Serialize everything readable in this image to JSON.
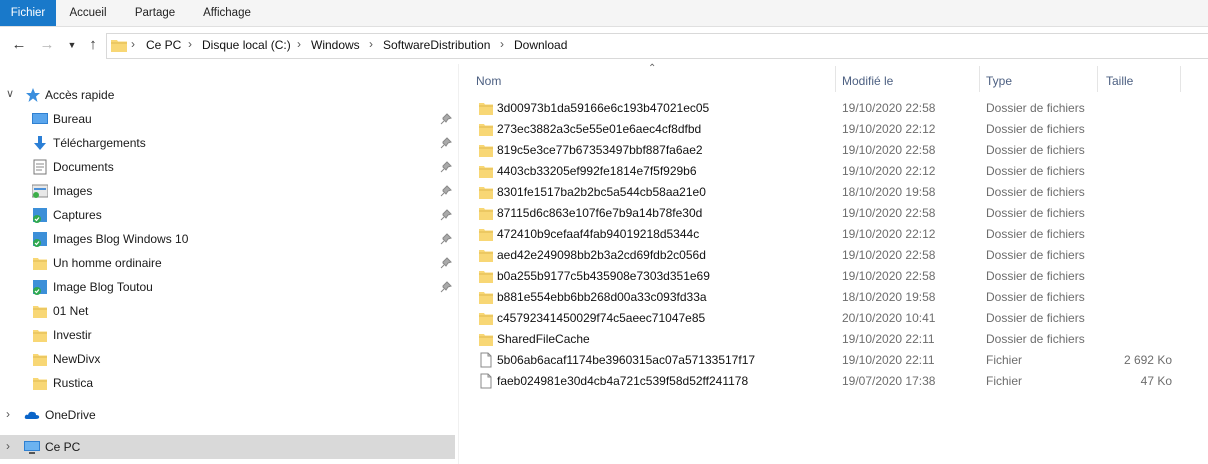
{
  "ribbon": {
    "tabs": [
      {
        "label": "Fichier",
        "active": true
      },
      {
        "label": "Accueil",
        "active": false
      },
      {
        "label": "Partage",
        "active": false
      },
      {
        "label": "Affichage",
        "active": false
      }
    ]
  },
  "address": {
    "icons": [
      "back-arrow-icon",
      "forward-arrow-icon",
      "recent-dropdown-icon",
      "up-arrow-icon",
      "folder-icon"
    ],
    "crumbs": [
      "Ce PC",
      "Disque local (C:)",
      "Windows",
      "SoftwareDistribution",
      "Download"
    ]
  },
  "nav": {
    "quick_access": "Accès rapide",
    "items": [
      {
        "label": "Bureau",
        "icon": "desktop-icon",
        "pinned": true
      },
      {
        "label": "Téléchargements",
        "icon": "download-arrow-icon",
        "pinned": true
      },
      {
        "label": "Documents",
        "icon": "document-icon",
        "pinned": true
      },
      {
        "label": "Images",
        "icon": "images-icon",
        "pinned": true
      },
      {
        "label": "Captures",
        "icon": "synced-folder-icon",
        "pinned": true
      },
      {
        "label": "Images Blog Windows 10",
        "icon": "synced-folder-icon",
        "pinned": true
      },
      {
        "label": "Un homme ordinaire",
        "icon": "folder-icon",
        "pinned": true
      },
      {
        "label": "Image Blog Toutou",
        "icon": "synced-folder-icon",
        "pinned": true
      },
      {
        "label": "01 Net",
        "icon": "folder-icon",
        "pinned": false
      },
      {
        "label": "Investir",
        "icon": "folder-icon",
        "pinned": false
      },
      {
        "label": "NewDivx",
        "icon": "folder-icon",
        "pinned": false
      },
      {
        "label": "Rustica",
        "icon": "folder-icon",
        "pinned": false
      }
    ],
    "onedrive": "OneDrive",
    "this_pc": "Ce PC"
  },
  "columns": {
    "name": "Nom",
    "modified": "Modifié le",
    "type": "Type",
    "size": "Taille"
  },
  "files": [
    {
      "name": "3d00973b1da59166e6c193b47021ec05",
      "date": "19/10/2020 22:58",
      "type": "Dossier de fichiers",
      "size": "",
      "kind": "folder"
    },
    {
      "name": "273ec3882a3c5e55e01e6aec4cf8dfbd",
      "date": "19/10/2020 22:12",
      "type": "Dossier de fichiers",
      "size": "",
      "kind": "folder"
    },
    {
      "name": "819c5e3ce77b67353497bbf887fa6ae2",
      "date": "19/10/2020 22:58",
      "type": "Dossier de fichiers",
      "size": "",
      "kind": "folder"
    },
    {
      "name": "4403cb33205ef992fe1814e7f5f929b6",
      "date": "19/10/2020 22:12",
      "type": "Dossier de fichiers",
      "size": "",
      "kind": "folder"
    },
    {
      "name": "8301fe1517ba2b2bc5a544cb58aa21e0",
      "date": "18/10/2020 19:58",
      "type": "Dossier de fichiers",
      "size": "",
      "kind": "folder"
    },
    {
      "name": "87115d6c863e107f6e7b9a14b78fe30d",
      "date": "19/10/2020 22:58",
      "type": "Dossier de fichiers",
      "size": "",
      "kind": "folder"
    },
    {
      "name": "472410b9cefaaf4fab94019218d5344c",
      "date": "19/10/2020 22:12",
      "type": "Dossier de fichiers",
      "size": "",
      "kind": "folder"
    },
    {
      "name": "aed42e249098bb2b3a2cd69fdb2c056d",
      "date": "19/10/2020 22:58",
      "type": "Dossier de fichiers",
      "size": "",
      "kind": "folder"
    },
    {
      "name": "b0a255b9177c5b435908e7303d351e69",
      "date": "19/10/2020 22:58",
      "type": "Dossier de fichiers",
      "size": "",
      "kind": "folder"
    },
    {
      "name": "b881e554ebb6bb268d00a33c093fd33a",
      "date": "18/10/2020 19:58",
      "type": "Dossier de fichiers",
      "size": "",
      "kind": "folder"
    },
    {
      "name": "c45792341450029f74c5aeec71047e85",
      "date": "20/10/2020 10:41",
      "type": "Dossier de fichiers",
      "size": "",
      "kind": "folder"
    },
    {
      "name": "SharedFileCache",
      "date": "19/10/2020 22:11",
      "type": "Dossier de fichiers",
      "size": "",
      "kind": "folder"
    },
    {
      "name": "5b06ab6acaf1174be3960315ac07a57133517f17",
      "date": "19/10/2020 22:11",
      "type": "Fichier",
      "size": "2 692 Ko",
      "kind": "file"
    },
    {
      "name": "faeb024981e30d4cb4a721c539f58d52ff241178",
      "date": "19/07/2020 17:38",
      "type": "Fichier",
      "size": "47 Ko",
      "kind": "file"
    }
  ],
  "colors": {
    "accent": "#1979ca",
    "folder": "#f8d775",
    "header_text": "#4d6082"
  }
}
